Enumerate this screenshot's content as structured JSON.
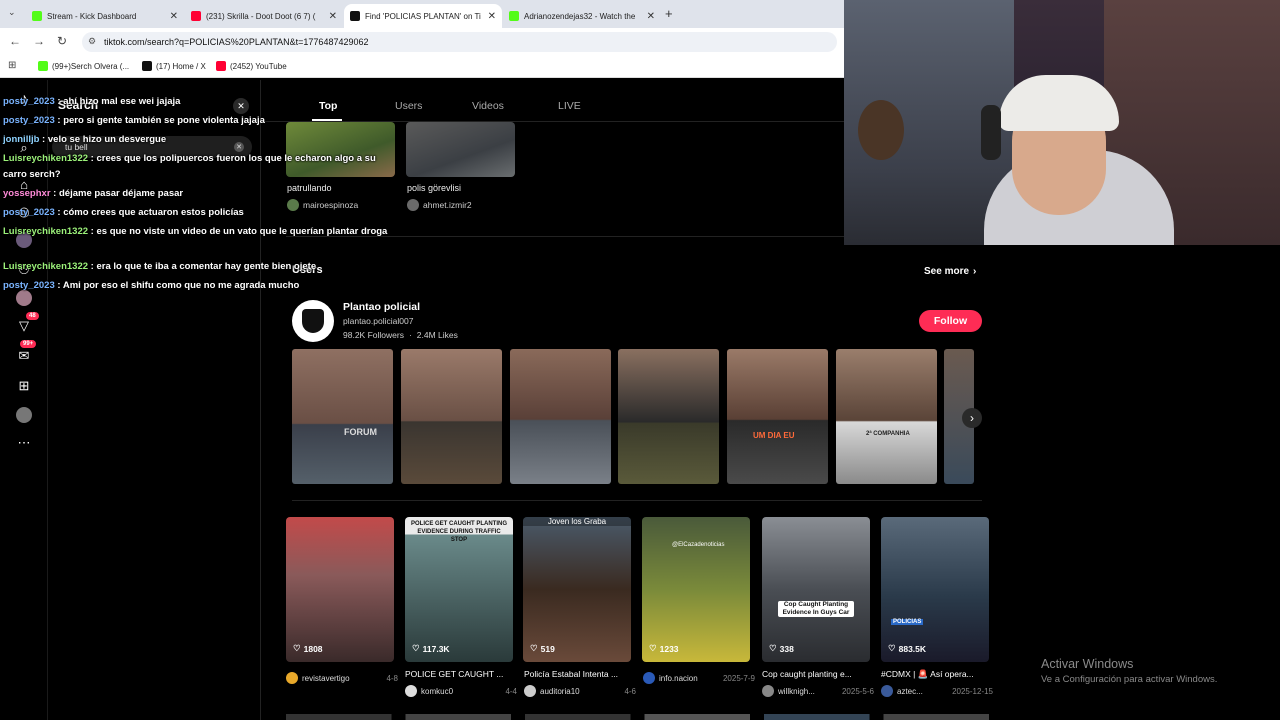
{
  "browser": {
    "tabs": [
      {
        "title": "Stream - Kick Dashboard",
        "favicon_color": "#53fc18",
        "active": false
      },
      {
        "title": "(231) Skrilla - Doot Doot (6 7) (",
        "favicon_color": "#ff0033",
        "active": false
      },
      {
        "title": "Find 'POLICIAS PLANTAN' on Ti",
        "favicon_color": "#111111",
        "active": true
      },
      {
        "title": "Adrianozendejas32 - Watch the",
        "favicon_color": "#53fc18",
        "active": false
      }
    ],
    "new_tab": "+",
    "url": "tiktok.com/search?q=POLICIAS%20PLANTAN&t=1776487429062",
    "bookmarks": [
      {
        "label": "(99+)Serch Olvera (...",
        "icon_color": "#53fc18"
      },
      {
        "label": "(17) Home / X",
        "icon_color": "#111111"
      },
      {
        "label": "(2452) YouTube",
        "icon_color": "#ff0033"
      }
    ]
  },
  "tiktok": {
    "search_title": "Search",
    "search_value": "tu bell",
    "nav_badges": {
      "inbox": "48",
      "messages": "99+"
    },
    "tabs": [
      "Top",
      "Users",
      "Videos",
      "LIVE"
    ],
    "top_results": [
      {
        "caption": "patrullando",
        "author": "mairoespinoza"
      },
      {
        "caption": "polis görevlisi",
        "author": "ahmet.izmir2"
      }
    ],
    "users_section": {
      "heading": "Users",
      "see_more": "See more",
      "user": {
        "name": "Plantao policial",
        "handle": "plantao.policial007",
        "followers": "98.2K Followers",
        "separator": "·",
        "likes": "2.4M Likes",
        "follow_label": "Follow"
      },
      "film_overlays": [
        "FORUM",
        "",
        "",
        "",
        "UM DIA EU",
        "2ª COMPANHIA",
        ""
      ]
    },
    "videos": [
      {
        "likes": "1808",
        "caption": "",
        "author": "revistavertigo",
        "date": "4-8",
        "overlay": "",
        "thumb_color": "#7a4f4f"
      },
      {
        "likes": "117.3K",
        "caption": "POLICE GET CAUGHT ...",
        "author": "komkuc0",
        "date": "4-4",
        "overlay": "POLICE GET CAUGHT PLANTING EVIDENCE DURING TRAFFIC STOP",
        "thumb_color": "#4d6a6a"
      },
      {
        "likes": "519",
        "caption": "Policía Estabal Intenta ...",
        "author": "auditoria10",
        "date": "4-6",
        "overlay": "Joven los Graba",
        "thumb_color": "#3d4f5c"
      },
      {
        "likes": "1233",
        "caption": "",
        "author": "info.nacion",
        "date": "2025-7-9",
        "overlay": "@ElCazadenoticias",
        "thumb_color": "#6a7f3a"
      },
      {
        "likes": "338",
        "caption": "Cop caught planting e...",
        "author": "willknigh...",
        "date": "2025-5-6",
        "overlay": "Cop Caught Planting Evidence In Guys Car",
        "thumb_color": "#5a5f66"
      },
      {
        "likes": "883.5K",
        "caption": "#CDMX | 🚨 Así opera...",
        "author": "aztec...",
        "date": "2025-12-15",
        "overlay": "POLICIAS",
        "thumb_color": "#2f3a4a"
      }
    ]
  },
  "chat": [
    {
      "user": "posty_2023",
      "text": "ahí hizo mal ese wei jajaja",
      "color": "#7ab4ff"
    },
    {
      "user": "posty_2023",
      "text": "pero si gente también se pone violenta jajaja",
      "color": "#7ab4ff"
    },
    {
      "user": "jonnilljb",
      "text": "velo se hizo un desvergue",
      "color": "#8fd3ff"
    },
    {
      "user": "Luisreychiken1322",
      "text": "crees que los polipuercos fueron los que le echaron algo a su carro serch?",
      "color": "#9cf27a"
    },
    {
      "user": "yossephxr",
      "text": "déjame pasar déjame pasar",
      "color": "#ff8ad8"
    },
    {
      "user": "posty_2023",
      "text": "cómo crees que actuaron estos policías",
      "color": "#7ab4ff"
    },
    {
      "user": "Luisreychiken1322",
      "text": "es que no viste un video de un vato que le querían plantar droga",
      "color": "#9cf27a"
    },
    {
      "user": "Luisreychiken1322",
      "text": "era lo que te iba a comentar hay gente bien ojete",
      "color": "#9cf27a"
    },
    {
      "user": "posty_2023",
      "text": "Ami por eso el shifu como que no me agrada mucho",
      "color": "#7ab4ff"
    }
  ],
  "watermark": {
    "title": "Activar Windows",
    "subtitle": "Ve a Configuración para activar Windows."
  }
}
